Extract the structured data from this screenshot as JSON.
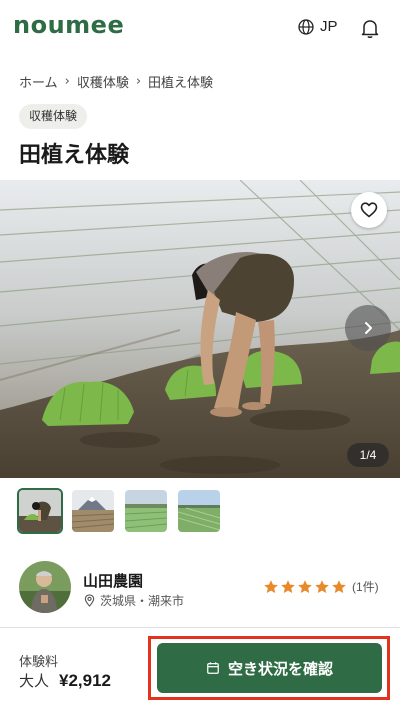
{
  "header": {
    "logo_text": "noumee",
    "lang_label": "JP",
    "globe_icon": "globe-icon",
    "bell_icon": "bell-icon"
  },
  "breadcrumb": {
    "items": [
      "ホーム",
      "収穫体験",
      "田植え体験"
    ],
    "separator_icon": "chevron-right-icon"
  },
  "category_tag": "収穫体験",
  "page_title": "田植え体験",
  "gallery": {
    "counter": "1/4",
    "favorite_icon": "heart-icon",
    "next_icon": "chevron-right-icon"
  },
  "host": {
    "name": "山田農園",
    "location": "茨城県・潮来市",
    "location_icon": "map-pin-icon",
    "rating": 5,
    "review_count": "(1件)",
    "star_color": "#e8892a"
  },
  "footer": {
    "price_label": "体験料",
    "price_who": "大人",
    "price_amount": "¥2,912",
    "cta_label": "空き状況を確認",
    "cta_icon": "calendar-icon"
  },
  "colors": {
    "brand": "#2f6b45",
    "highlight": "#e2331f"
  }
}
